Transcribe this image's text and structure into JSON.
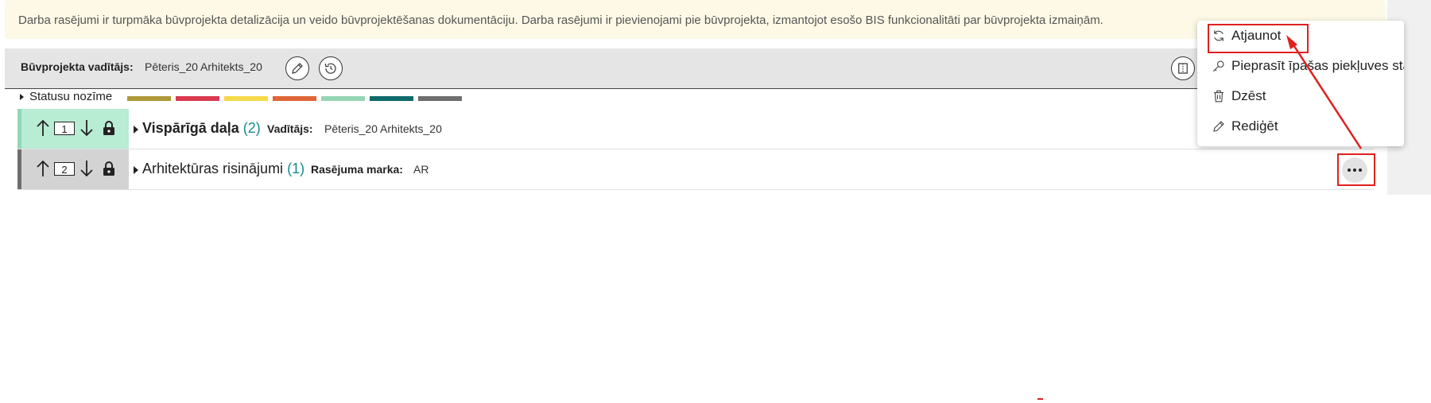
{
  "notice": {
    "text": "Darba rasējumi ir turpmāka būvprojekta detalizācija un veido būvprojektēšanas dokumentāciju. Darba rasējumi ir pievienojami pie būvprojekta, izmantojot esošo BIS funkcionalitāti par būvprojekta izmaiņām."
  },
  "manager": {
    "label": "Būvprojekta vadītājs:",
    "value": "Pēteris_20 Arhitekts_20",
    "edit_icon": "pencil-icon",
    "history_icon": "history-icon",
    "panel_icon": "split-panel-icon"
  },
  "legend": {
    "label": "Statusu nozīme",
    "colors": [
      "#b0993a",
      "#d93a50",
      "#f5d94a",
      "#e0663a",
      "#95d6b5",
      "#0f6b6b",
      "#6e6e6e"
    ]
  },
  "rows": [
    {
      "order": "1",
      "title": "Vispārīgā daļa",
      "count": "(2)",
      "field_label": "Vadītājs:",
      "field_value": "Pēteris_20 Arhitekts_20",
      "status_color": "#95d6b5",
      "bg_color": "#b8ecd3"
    },
    {
      "order": "2",
      "title": "Arhitektūras risinājumi",
      "count": "(1)",
      "field_label": "Rasējuma marka:",
      "field_value": "AR",
      "status_color": "#6e6e6e",
      "bg_color": "#d3d3d3"
    }
  ],
  "menu": {
    "items": [
      {
        "label": "Atjaunot",
        "icon": "refresh-icon"
      },
      {
        "label": "Pieprasīt īpašas piekļuves statu",
        "icon": "key-icon"
      },
      {
        "label": "Dzēst",
        "icon": "trash-icon"
      },
      {
        "label": "Rediģēt",
        "icon": "pencil-icon"
      }
    ]
  },
  "highlight_color": "#e02020"
}
